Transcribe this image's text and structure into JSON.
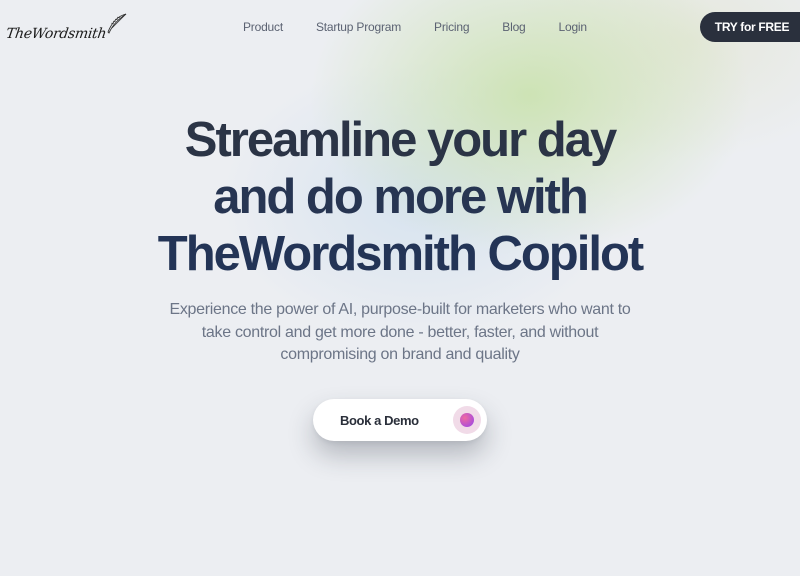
{
  "brand": {
    "logo_text": "TheWordsmith",
    "logo_icon": "quill-icon"
  },
  "nav": {
    "items": [
      {
        "label": "Product"
      },
      {
        "label": "Startup Program"
      },
      {
        "label": "Pricing"
      },
      {
        "label": "Blog"
      },
      {
        "label": "Login"
      }
    ],
    "cta_label": "TRY for FREE"
  },
  "hero": {
    "title_lines": [
      "Streamline your day",
      "and do more with",
      "TheWordsmith Copilot"
    ],
    "subtitle_lines": [
      "Experience the power of AI, purpose-built for marketers who want to",
      "take control and get more done - better, faster, and without",
      "compromising on brand and quality"
    ],
    "demo_label": "Book a Demo",
    "demo_icon": "gradient-dot-icon"
  },
  "colors": {
    "background": "#eceef2",
    "cta_background": "#2a303d",
    "title_text": "#283149",
    "subtitle_text": "#6c7587",
    "accent_glow": "#c8e1aa",
    "dot_gradient_start": "#f06aa0",
    "dot_gradient_end": "#8d4de0"
  }
}
